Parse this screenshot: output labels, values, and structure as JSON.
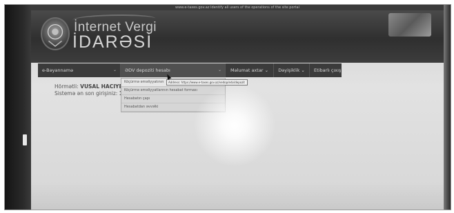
{
  "browser": {
    "top_strip_text": "www.e-taxes.gov.az  Identify all users of the operations of the site portal"
  },
  "header": {
    "title_line1": "İnternet Vergi",
    "title_line2": "İDARƏSİ",
    "emblem_icon": "tax-authority-emblem-icon"
  },
  "navbar": {
    "items": [
      {
        "label": "e-Bəyannamə",
        "has_caret": true
      },
      {
        "label": "ƏDV depoziti hesabı",
        "has_caret": true
      },
      {
        "label": "Məlumat axtar",
        "has_caret": true
      },
      {
        "label": "Dəyişiklik",
        "has_caret": true
      },
      {
        "label": "Etibarlı çıxış",
        "has_caret": false
      }
    ],
    "caret": "⌄"
  },
  "dropdown": {
    "items": [
      "Köçürmə əməliyyatının",
      "Köçürmə əməliyyatlarının hesabat forması",
      "Hesabatın çapı",
      "Hesabatdan əvvəlki"
    ]
  },
  "tooltip": {
    "text": "Address: https://www.e-taxes.gov.az/vedop/edv/depozit"
  },
  "main": {
    "greeting_label": "Hörmətli:",
    "user_name": "VUSAL HACIYEV",
    "last_login_label": "Sistemə ən son girişiniz:",
    "last_login_value": "13"
  },
  "colors": {
    "navbar_bg": "#3b3b3b",
    "banner_bg": "#2f2f2f",
    "screen_bg": "#e2e2e2"
  }
}
